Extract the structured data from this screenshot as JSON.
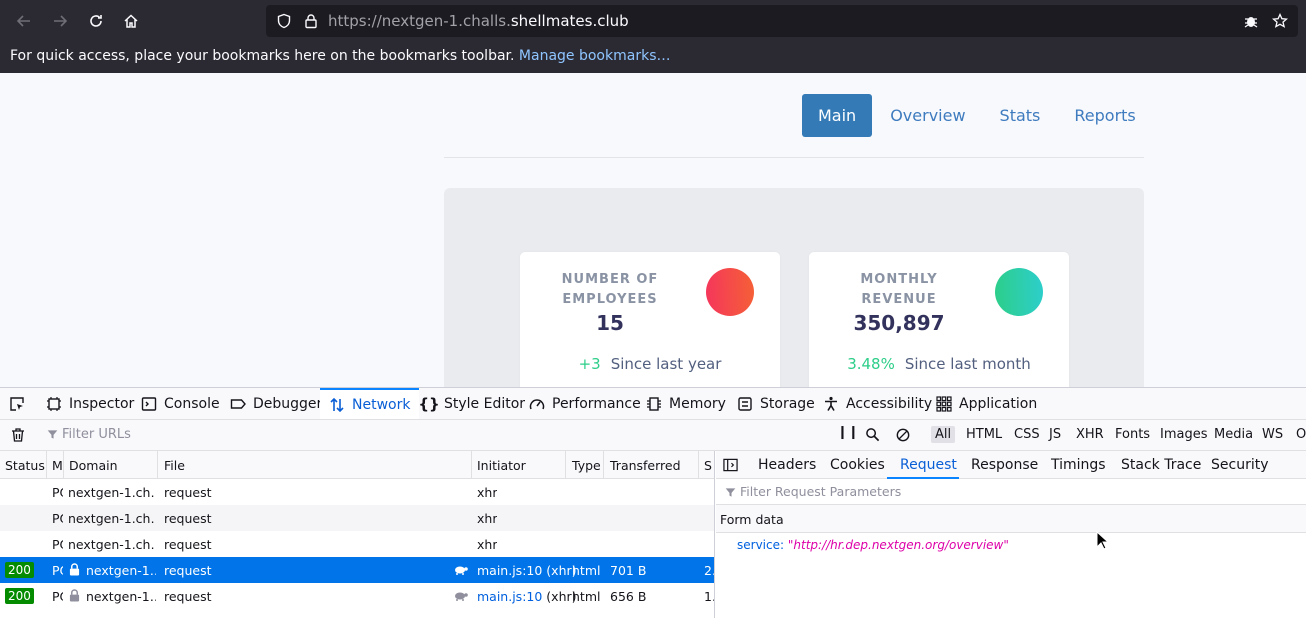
{
  "browser": {
    "url_prefix": "https://nextgen-1.challs.",
    "url_domain": "shellmates.club",
    "bookmarks_text": "For quick access, place your bookmarks here on the bookmarks toolbar.",
    "bookmarks_link": "Manage bookmarks…"
  },
  "page": {
    "nav": [
      "Main",
      "Overview",
      "Stats",
      "Reports"
    ],
    "cards": [
      {
        "title": "NUMBER OF EMPLOYEES",
        "value": "15",
        "change": "+3",
        "period": "Since last year",
        "color_from": "#f5365c",
        "color_to": "#f56036"
      },
      {
        "title": "MONTHLY REVENUE",
        "value": "350,897",
        "change": "3.48%",
        "period": "Since last month",
        "color_from": "#2dce89",
        "color_to": "#2dcecc"
      }
    ]
  },
  "devtools": {
    "tabs": [
      "Inspector",
      "Console",
      "Debugger",
      "Network",
      "Style Editor",
      "Performance",
      "Memory",
      "Storage",
      "Accessibility",
      "Application"
    ],
    "filter_placeholder": "Filter URLs",
    "type_filters": [
      "All",
      "HTML",
      "CSS",
      "JS",
      "XHR",
      "Fonts",
      "Images",
      "Media",
      "WS",
      "O"
    ],
    "columns": [
      "Status",
      "M",
      "Domain",
      "File",
      "Initiator",
      "Type",
      "Transferred",
      "S"
    ],
    "requests": [
      {
        "status": "",
        "method": "PO",
        "domain": "nextgen-1.ch…",
        "file": "request",
        "initiator": "xhr",
        "type": "",
        "transferred": "",
        "size": ""
      },
      {
        "status": "",
        "method": "PO",
        "domain": "nextgen-1.ch…",
        "file": "request",
        "initiator": "xhr",
        "type": "",
        "transferred": "",
        "size": ""
      },
      {
        "status": "",
        "method": "PO",
        "domain": "nextgen-1.ch…",
        "file": "request",
        "initiator": "xhr",
        "type": "",
        "transferred": "",
        "size": ""
      },
      {
        "status": "200",
        "method": "PO",
        "domain": "nextgen-1…",
        "file": "request",
        "initiator": "main.js:10",
        "initiator_extra": "(xhr)",
        "type": "html",
        "transferred": "701 B",
        "size": "2."
      },
      {
        "status": "200",
        "method": "PO",
        "domain": "nextgen-1…",
        "file": "request",
        "initiator": "main.js:10",
        "initiator_extra": "(xhr)",
        "type": "html",
        "transferred": "656 B",
        "size": "1."
      }
    ],
    "detail_tabs": [
      "Headers",
      "Cookies",
      "Request",
      "Response",
      "Timings",
      "Stack Trace",
      "Security"
    ],
    "params_placeholder": "Filter Request Parameters",
    "form_data_label": "Form data",
    "form_key": "service:",
    "form_value": "\"http://hr.dep.nextgen.org/overview\""
  }
}
